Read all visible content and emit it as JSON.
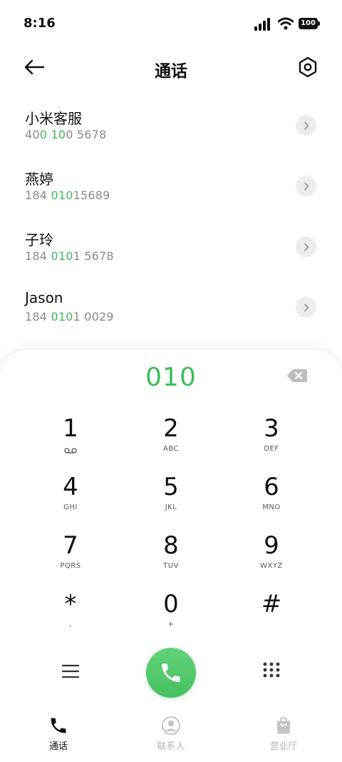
{
  "status_bar": {
    "time": "8:16",
    "battery": "100"
  },
  "header": {
    "title": "通话"
  },
  "contacts": [
    {
      "name": "小米客服",
      "number_parts": [
        {
          "t": "40",
          "hl": false
        },
        {
          "t": "0",
          "hl": true
        },
        {
          "t": " ",
          "hl": false
        },
        {
          "t": "10",
          "hl": true
        },
        {
          "t": "0 5678",
          "hl": false
        }
      ]
    },
    {
      "name": "燕婷",
      "number_parts": [
        {
          "t": "184 ",
          "hl": false
        },
        {
          "t": "010",
          "hl": true
        },
        {
          "t": "15689",
          "hl": false
        }
      ]
    },
    {
      "name": "子玲",
      "number_parts": [
        {
          "t": "184 ",
          "hl": false
        },
        {
          "t": "010",
          "hl": true
        },
        {
          "t": "1 5678",
          "hl": false
        }
      ]
    },
    {
      "name": "Jason",
      "number_parts": [
        {
          "t": "184 ",
          "hl": false
        },
        {
          "t": "010",
          "hl": true
        },
        {
          "t": "1 0029",
          "hl": false
        }
      ]
    }
  ],
  "dialer": {
    "input_value": "010",
    "keys": [
      {
        "digit": "1",
        "letters": ""
      },
      {
        "digit": "2",
        "letters": "ABC"
      },
      {
        "digit": "3",
        "letters": "DEF"
      },
      {
        "digit": "4",
        "letters": "GHI"
      },
      {
        "digit": "5",
        "letters": "JKL"
      },
      {
        "digit": "6",
        "letters": "MNO"
      },
      {
        "digit": "7",
        "letters": "PQRS"
      },
      {
        "digit": "8",
        "letters": "TUV"
      },
      {
        "digit": "9",
        "letters": "WXYZ"
      },
      {
        "digit": "*",
        "letters": ","
      },
      {
        "digit": "0",
        "letters": "+"
      },
      {
        "digit": "#",
        "letters": ""
      }
    ]
  },
  "bottom_nav": {
    "items": [
      {
        "label": "通话",
        "icon": "phone-icon",
        "active": true
      },
      {
        "label": "联系人",
        "icon": "contact-icon",
        "active": false
      },
      {
        "label": "营业厅",
        "icon": "bag-icon",
        "active": false
      }
    ]
  },
  "colors": {
    "accent": "#3dbd5a",
    "call_button": "#52c86a"
  }
}
